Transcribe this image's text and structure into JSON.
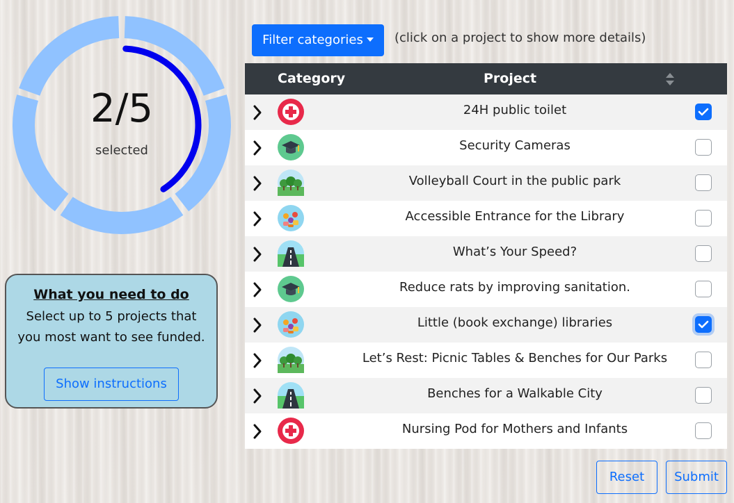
{
  "counter": {
    "selected": 2,
    "max": 5,
    "text": "2/5",
    "label": "selected",
    "fraction": 0.4
  },
  "colors": {
    "accent": "#0d6efd",
    "ring_track": "#90c2ff",
    "ring_progress": "#0000ee",
    "header_bg": "#343a40",
    "todo_bg": "#add8e6"
  },
  "instructions": {
    "title": "What you need to do",
    "text": "Select up to 5 projects that you most want to see funded.",
    "button_label": "Show instructions"
  },
  "filter": {
    "button_label": "Filter categories",
    "hint": "(click on a project to show more details)"
  },
  "table": {
    "headers": {
      "category": "Category",
      "project": "Project"
    },
    "rows": [
      {
        "category_icon": "health-cross-icon",
        "project": "24H public toilet",
        "checked": true
      },
      {
        "category_icon": "education-cap-icon",
        "project": "Security Cameras",
        "checked": false
      },
      {
        "category_icon": "park-trees-icon",
        "project": "Volleyball Court in the public park",
        "checked": false
      },
      {
        "category_icon": "community-people-icon",
        "project": "Accessible Entrance for the Library",
        "checked": false
      },
      {
        "category_icon": "road-icon",
        "project": "What’s Your Speed?",
        "checked": false
      },
      {
        "category_icon": "education-cap-icon",
        "project": "Reduce rats by improving sanitation.",
        "checked": false
      },
      {
        "category_icon": "community-people-icon",
        "project": "Little (book exchange) libraries",
        "checked": true
      },
      {
        "category_icon": "park-trees-icon",
        "project": "Let’s Rest: Picnic Tables & Benches for Our Parks",
        "checked": false
      },
      {
        "category_icon": "road-icon",
        "project": "Benches for a Walkable City",
        "checked": false
      },
      {
        "category_icon": "health-cross-icon",
        "project": "Nursing Pod for Mothers and Infants",
        "checked": false
      }
    ]
  },
  "actions": {
    "reset_label": "Reset",
    "submit_label": "Submit"
  }
}
